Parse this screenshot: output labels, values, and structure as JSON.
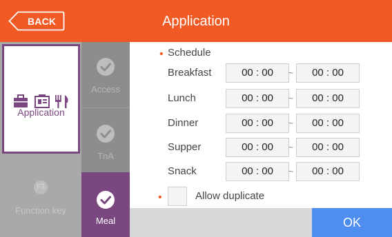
{
  "header": {
    "back_label": "BACK",
    "title": "Application"
  },
  "sidebar": {
    "application_label": "Application",
    "function_key_badge": "F2",
    "function_key_label": "Function key",
    "icons": [
      "briefcase-icon",
      "id-card-icon",
      "fork-knife-icon"
    ]
  },
  "tabs": [
    {
      "label": "Access",
      "selected": false
    },
    {
      "label": "TnA",
      "selected": false
    },
    {
      "label": "Meal",
      "selected": true
    }
  ],
  "schedule": {
    "title": "Schedule",
    "rows": [
      {
        "label": "Breakfast",
        "start": "00 : 00",
        "end": "00 : 00"
      },
      {
        "label": "Lunch",
        "start": "00 : 00",
        "end": "00 : 00"
      },
      {
        "label": "Dinner",
        "start": "00 : 00",
        "end": "00 : 00"
      },
      {
        "label": "Supper",
        "start": "00 : 00",
        "end": "00 : 00"
      },
      {
        "label": "Snack",
        "start": "00 : 00",
        "end": "00 : 00"
      }
    ],
    "separator": "~"
  },
  "allow_duplicate": {
    "label": "Allow duplicate",
    "checked": false
  },
  "footer": {
    "ok_label": "OK"
  },
  "colors": {
    "header": "#f15a24",
    "accent": "#7b4780",
    "ok": "#4d8ef0"
  }
}
